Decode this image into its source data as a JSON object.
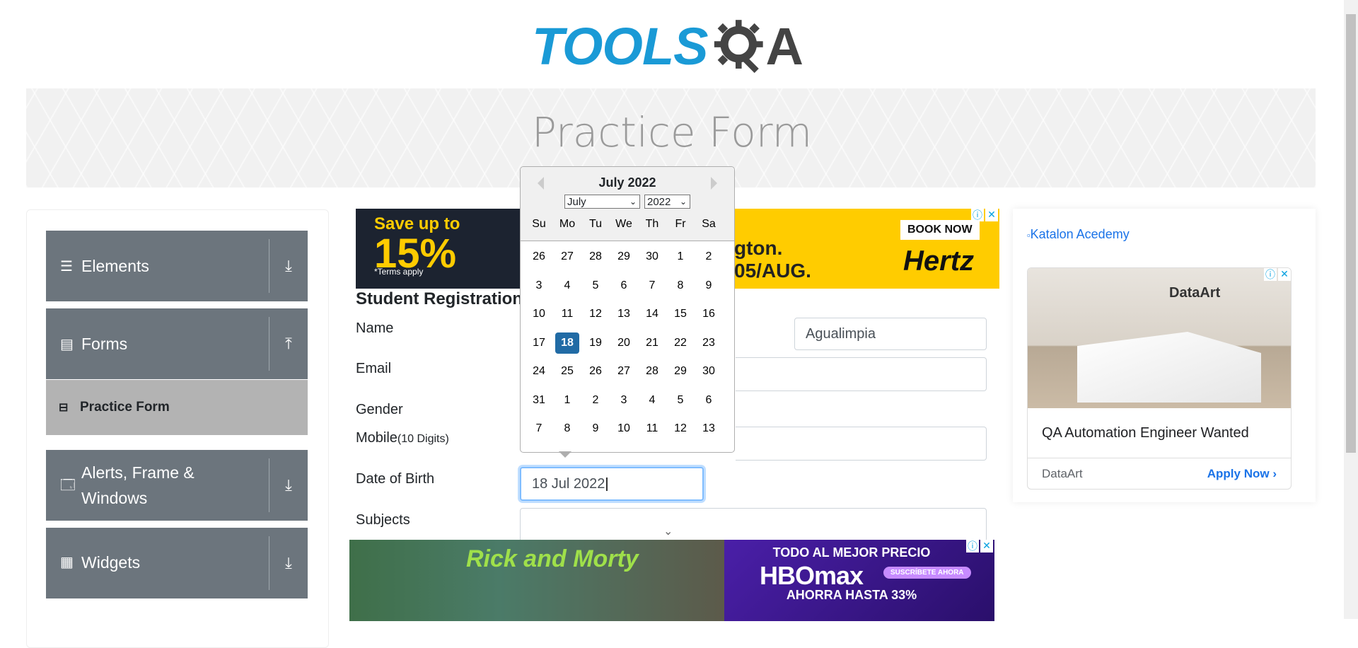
{
  "logo": {
    "part1": "TOOLS",
    "part2": "A"
  },
  "banner": {
    "title": "Practice Form"
  },
  "sidebar": {
    "groups": [
      {
        "label": "Elements",
        "icon": "hamburger-icon",
        "toggle": "download-icon"
      },
      {
        "label": "Forms",
        "icon": "document-icon",
        "toggle": "upload-icon"
      },
      {
        "label": "Alerts, Frame & Windows",
        "icon": "window-icon",
        "toggle": "download-icon"
      },
      {
        "label": "Widgets",
        "icon": "widgets-icon",
        "toggle": "download-icon"
      }
    ],
    "active_item": "Practice Form"
  },
  "form": {
    "heading": "Student Registration",
    "name_label": "Name",
    "last_name_value": "Agualimpia",
    "email_label": "Email",
    "gender_label": "Gender",
    "mobile_label": "Mobile",
    "mobile_hint": "(10 Digits)",
    "dob_label": "Date of Birth",
    "dob_value": "18 Jul 2022",
    "subjects_label": "Subjects"
  },
  "datepicker": {
    "title": "July 2022",
    "month_select": "July",
    "year_select": "2022",
    "day_names": [
      "Su",
      "Mo",
      "Tu",
      "We",
      "Th",
      "Fr",
      "Sa"
    ],
    "weeks": [
      [
        "26",
        "27",
        "28",
        "29",
        "30",
        "1",
        "2"
      ],
      [
        "3",
        "4",
        "5",
        "6",
        "7",
        "8",
        "9"
      ],
      [
        "10",
        "11",
        "12",
        "13",
        "14",
        "15",
        "16"
      ],
      [
        "17",
        "18",
        "19",
        "20",
        "21",
        "22",
        "23"
      ],
      [
        "24",
        "25",
        "26",
        "27",
        "28",
        "29",
        "30"
      ],
      [
        "31",
        "1",
        "2",
        "3",
        "4",
        "5",
        "6"
      ],
      [
        "7",
        "8",
        "9",
        "10",
        "11",
        "12",
        "13"
      ]
    ],
    "selected": "18"
  },
  "ads": {
    "top": {
      "save_line": "Save up to",
      "save_pct": "15%",
      "terms": "*Terms apply",
      "mid1": "gton.",
      "mid2": "05/AUG.",
      "book": "BOOK NOW",
      "brand": "Hertz"
    },
    "right": {
      "link_text": "Katalon Acedemy",
      "brand": "DataArt",
      "title": "QA Automation Engineer Wanted",
      "company": "DataArt",
      "cta": "Apply Now"
    },
    "bottom": {
      "show": "Rick and Morty",
      "line1": "TODO AL MEJOR PRECIO",
      "brand": "HBOmax",
      "subscribe": "SUSCRÍBETE AHORA",
      "line2": "AHORRA HASTA 33%"
    }
  },
  "colors": {
    "accent": "#216ba5",
    "sidebar": "#6c757d",
    "active": "#b3b3b3"
  }
}
